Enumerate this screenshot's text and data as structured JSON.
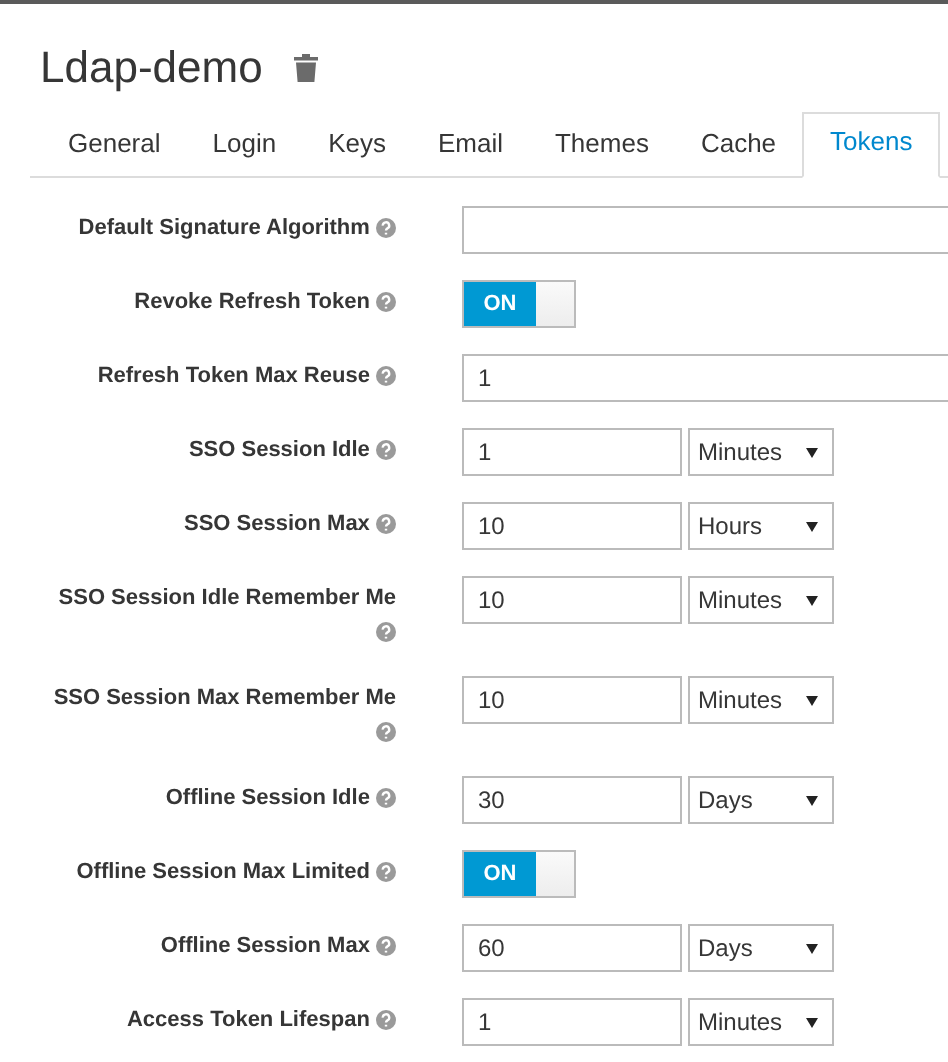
{
  "realm": {
    "title": "Ldap-demo"
  },
  "tabs": [
    {
      "label": "General",
      "selected": false
    },
    {
      "label": "Login",
      "selected": false
    },
    {
      "label": "Keys",
      "selected": false
    },
    {
      "label": "Email",
      "selected": false
    },
    {
      "label": "Themes",
      "selected": false
    },
    {
      "label": "Cache",
      "selected": false
    },
    {
      "label": "Tokens",
      "selected": true
    }
  ],
  "fields": [
    {
      "kind": "text",
      "label": "Default Signature Algorithm"
    },
    {
      "kind": "toggle",
      "label": "Revoke Refresh Token",
      "on": true,
      "state_text": "ON"
    },
    {
      "kind": "text",
      "label": "Refresh Token Max Reuse",
      "value": "1"
    },
    {
      "kind": "duration",
      "label": "SSO Session Idle",
      "value": "1",
      "unit": "Minutes"
    },
    {
      "kind": "duration",
      "label": "SSO Session Max",
      "value": "10",
      "unit": "Hours"
    },
    {
      "kind": "duration",
      "label": "SSO Session Idle Remember Me",
      "value": "10",
      "unit": "Minutes"
    },
    {
      "kind": "duration",
      "label": "SSO Session Max Remember Me",
      "value": "10",
      "unit": "Minutes"
    },
    {
      "kind": "duration",
      "label": "Offline Session Idle",
      "value": "30",
      "unit": "Days"
    },
    {
      "kind": "toggle",
      "label": "Offline Session Max Limited",
      "on": true,
      "state_text": "ON"
    },
    {
      "kind": "duration",
      "label": "Offline Session Max",
      "value": "60",
      "unit": "Days"
    },
    {
      "kind": "duration",
      "label": "Access Token Lifespan",
      "value": "1",
      "unit": "Minutes"
    }
  ]
}
